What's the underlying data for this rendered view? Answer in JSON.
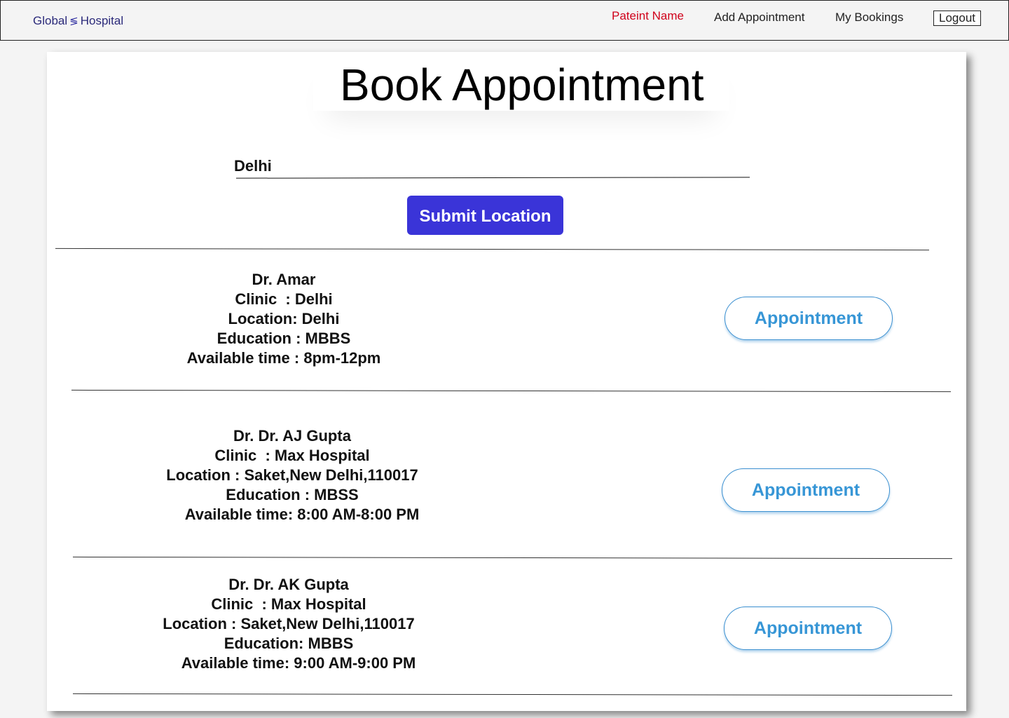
{
  "header": {
    "brand_left": "Global",
    "brand_right": "Hospital",
    "brand_icon": "logo-stripes-icon",
    "patient_name": "Pateint Name",
    "add_appointment": "Add Appointment",
    "my_bookings": "My Bookings",
    "logout": "Logout"
  },
  "main": {
    "title": "Book Appointment",
    "location_value": "Delhi",
    "submit_label": "Submit Location",
    "appointment_label": "Appointment",
    "doctors": [
      {
        "name": "Dr. Amar",
        "clinic": "Clinic  : Delhi",
        "location": "Location: Delhi",
        "education": "Education : MBBS",
        "available": "Available time : 8pm-12pm"
      },
      {
        "name": "Dr. Dr. AJ Gupta",
        "clinic": "Clinic  : Max Hospital",
        "location": "Location : Saket,New Delhi,110017",
        "education": "Education : MBSS",
        "available": "Available time: 8:00 AM-8:00 PM"
      },
      {
        "name": "Dr. Dr. AK Gupta",
        "clinic": "Clinic  : Max Hospital",
        "location": "Location : Saket,New Delhi,110017",
        "education": "Education: MBBS",
        "available": "Available time: 9:00 AM-9:00 PM"
      }
    ]
  },
  "colors": {
    "accent": "#3a34d8",
    "patient_name": "#d0021b",
    "appointment_text": "#3796d6"
  }
}
